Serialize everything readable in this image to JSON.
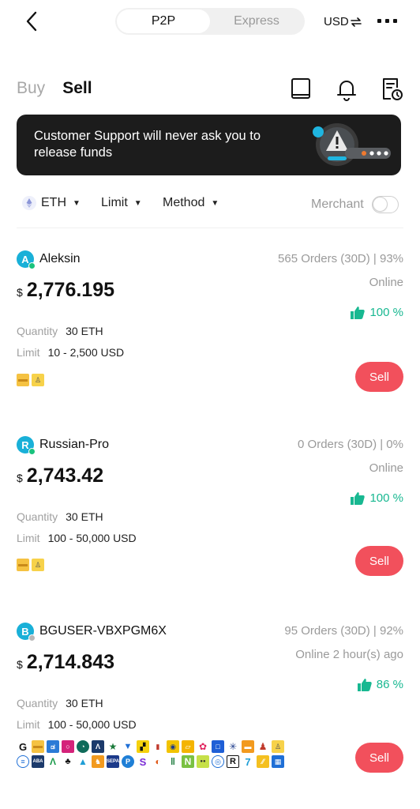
{
  "topbar": {
    "segments": [
      "P2P",
      "Express"
    ],
    "active_segment": "P2P",
    "currency": "USD",
    "currency_swap_icon": "swap-icon"
  },
  "tabs": {
    "buy": "Buy",
    "sell": "Sell",
    "active": "Sell"
  },
  "header_icons": [
    "book-icon",
    "bell-icon",
    "order-history-icon"
  ],
  "banner": {
    "text": "Customer Support will never ask you to release funds"
  },
  "filters": {
    "asset": "ETH",
    "limit": "Limit",
    "method": "Method",
    "merchant": "Merchant",
    "merchant_toggle": false
  },
  "colors": {
    "accent_red": "#f2505c",
    "positive_green": "#18b891",
    "avatar_blue": "#19b0d8"
  },
  "listings": [
    {
      "avatar_letter": "A",
      "name": "Aleksin",
      "orders": "565 Orders (30D) | 93%",
      "currency_symbol": "$",
      "price": "2,776.195",
      "status": "Online",
      "rating": "100 %",
      "quantity_label": "Quantity",
      "quantity": "30 ETH",
      "limit_label": "Limit",
      "limit": "10 - 2,500 USD",
      "action": "Sell"
    },
    {
      "avatar_letter": "R",
      "name": "Russian-Pro",
      "orders": "0 Orders (30D) | 0%",
      "currency_symbol": "$",
      "price": "2,743.42",
      "status": "Online",
      "rating": "100 %",
      "quantity_label": "Quantity",
      "quantity": "30 ETH",
      "limit_label": "Limit",
      "limit": "100 - 50,000 USD",
      "action": "Sell"
    },
    {
      "avatar_letter": "B",
      "name": "BGUSER-VBXPGM6X",
      "orders": "95 Orders (30D) | 92%",
      "currency_symbol": "$",
      "price": "2,714.843",
      "status": "Online 2 hour(s) ago",
      "rating": "86 %",
      "quantity_label": "Quantity",
      "quantity": "30 ETH",
      "limit_label": "Limit",
      "limit": "100 - 50,000 USD",
      "action": "Sell"
    }
  ]
}
